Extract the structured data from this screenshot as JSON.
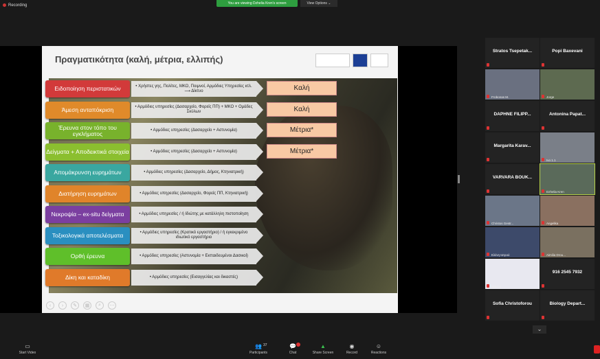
{
  "top": {
    "recording": "Recording",
    "viewing": "You are viewing Dzhelia Kren's screen",
    "view_options": "View Options ⌄"
  },
  "slide": {
    "title": "Πραγματικότητα (καλή, μέτρια, ελλιπής)",
    "rows": [
      {
        "category": "Ειδοποίηση περιστατικών",
        "color": "#d23a3a",
        "desc": "• Χρήστες γης, Πολίτες, ΜΚΟ, Ποιμνοί, Αρμόδιες Υπηρεσίες κτλ. ⟶ Δίκτυο",
        "rating": "Καλή"
      },
      {
        "category": "Άμεση ανταπόκριση",
        "color": "#e08a2a",
        "desc": "• Αρμόδιες υπηρεσίες (Δασαρχείο, Φορείς ΠΠ) + ΜΚΟ + Ομάδες Σκύλων",
        "rating": "Καλή"
      },
      {
        "category": "Έρευνα στον τόπο του εγκλήματος",
        "color": "#78b22c",
        "desc": "• Αρμόδιες υπηρεσίες (Δασαρχείο + Αστυνομία)",
        "rating": "Μέτρια*"
      },
      {
        "category": "Δείγματα + Αποδεικτικά στοιχεία",
        "color": "#8bbf2f",
        "desc": "• Αρμόδιες υπηρεσίες (Δασαρχείο + Αστυνομία)",
        "rating": "Μέτρια*"
      },
      {
        "category": "Απομάκρυνση ευρημάτων",
        "color": "#3aa7a0",
        "desc": "• Αρμόδιες υπηρεσίες (Δασαρχείο, Δήμος, Κτηνιατρική)",
        "rating": ""
      },
      {
        "category": "Διατήρηση ευρημάτων",
        "color": "#e0842a",
        "desc": "• Αρμόδιες υπηρεσίες (Δασαρχείο, Φορείς ΠΠ, Κτηνιατρική)",
        "rating": ""
      },
      {
        "category": "Νεκροψία – ex-situ δείγματα",
        "color": "#7b3fa0",
        "desc": "• Αρμόδιες υπηρεσίες / ή Ιδιώτης με κατάλληλη πιστοποίηση",
        "rating": ""
      },
      {
        "category": "Τοξικολογικά αποτελέσματα",
        "color": "#2a8fc0",
        "desc": "• Αρμόδιες υπηρεσίες (Κρατικό εργαστήριο) / ή εγκεκριμένο ιδιωτικό εργαστήριο",
        "rating": ""
      },
      {
        "category": "Ορθή έρευνα",
        "color": "#5fbf2a",
        "desc": "• Αρμόδιες υπηρεσίες (Αστυνομία + Εκπαιδευμένοι Δασικοί)",
        "rating": ""
      },
      {
        "category": "Δίκη και καταδίκη",
        "color": "#e07a2a",
        "desc": "• Αρμόδιες υπηρεσίες (Εισαγγελίας και δικαστές)",
        "rating": ""
      }
    ]
  },
  "participants": [
    {
      "name": "Stratos Tsepetak...",
      "label": "",
      "video": false
    },
    {
      "name": "Popi Baxevani",
      "label": "",
      "video": false
    },
    {
      "name": "",
      "label": "Frobonas M.",
      "video": true
    },
    {
      "name": "",
      "label": "Jorge",
      "video": true
    },
    {
      "name": "DAPHNE FILIPP...",
      "label": "",
      "video": false
    },
    {
      "name": "Antonina Papat...",
      "label": "",
      "video": false
    },
    {
      "name": "Margarita Karav...",
      "label": "",
      "video": false
    },
    {
      "name": "",
      "label": "Ivo 1.1",
      "video": true
    },
    {
      "name": "VARVARA BOUK...",
      "label": "",
      "video": false
    },
    {
      "name": "",
      "label": "Dzhelia Kren",
      "video": true
    },
    {
      "name": "",
      "label": "Christos Gestr...",
      "video": true
    },
    {
      "name": "",
      "label": "Angelika",
      "video": true
    },
    {
      "name": "",
      "label": "Ελένη Ιατρού",
      "video": true
    },
    {
      "name": "",
      "label": "Aimilia Drou...",
      "video": true
    },
    {
      "name": "",
      "label": "Spyros",
      "video": true
    },
    {
      "name": "916 2545 7932",
      "label": "",
      "video": false
    },
    {
      "name": "Sofia Christoforou",
      "label": "",
      "video": false
    },
    {
      "name": "Biology Depart...",
      "label": "",
      "video": false
    }
  ],
  "toolbar": {
    "start_video": "Start Video",
    "participants": "Participants",
    "participants_count": "37",
    "chat": "Chat",
    "share_screen": "Share Screen",
    "record": "Record",
    "reactions": "Reactions"
  }
}
